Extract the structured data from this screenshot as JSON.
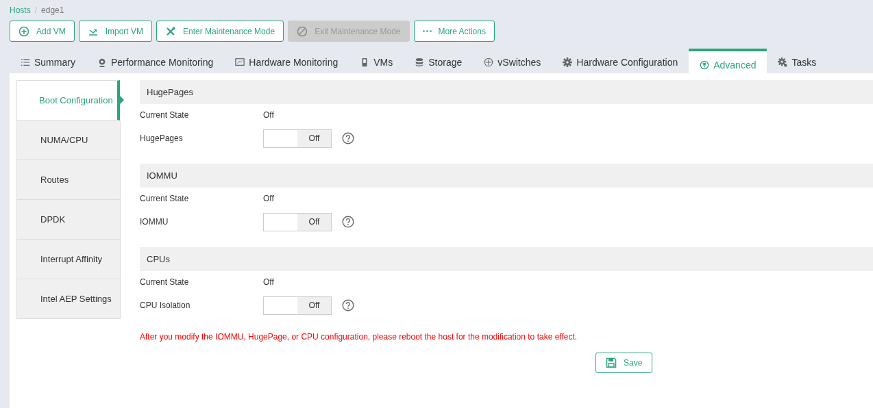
{
  "breadcrumb": {
    "items": [
      "Hosts",
      "edge1"
    ],
    "separator": "/"
  },
  "actions": [
    {
      "label": "Add VM",
      "disabled": false
    },
    {
      "label": "Import VM",
      "disabled": false
    },
    {
      "label": "Enter Maintenance Mode",
      "disabled": false
    },
    {
      "label": "Exit Maintenance Mode",
      "disabled": true
    },
    {
      "label": "More Actions",
      "disabled": false
    }
  ],
  "tabs": [
    {
      "label": "Summary",
      "selected": false
    },
    {
      "label": "Performance Monitoring",
      "selected": false
    },
    {
      "label": "Hardware Monitoring",
      "selected": false
    },
    {
      "label": "VMs",
      "selected": false
    },
    {
      "label": "Storage",
      "selected": false
    },
    {
      "label": "vSwitches",
      "selected": false
    },
    {
      "label": "Hardware Configuration",
      "selected": false
    },
    {
      "label": "Advanced",
      "selected": true
    },
    {
      "label": "Tasks",
      "selected": false
    }
  ],
  "sidebar": {
    "items": [
      {
        "label": "Boot Configuration",
        "selected": true
      },
      {
        "label": "NUMA/CPU",
        "selected": false
      },
      {
        "label": "Routes",
        "selected": false
      },
      {
        "label": "DPDK",
        "selected": false
      },
      {
        "label": "Interrupt Affinity",
        "selected": false
      },
      {
        "label": "Intel AEP Settings",
        "selected": false
      }
    ]
  },
  "sections": [
    {
      "title": "HugePages",
      "state_label": "Current State",
      "state_value": "Off",
      "switch_label": "HugePages",
      "switch": {
        "on": false,
        "text": "Off"
      }
    },
    {
      "title": "IOMMU",
      "state_label": "Current State",
      "state_value": "Off",
      "switch_label": "IOMMU",
      "switch": {
        "on": false,
        "text": "Off"
      }
    },
    {
      "title": "CPUs",
      "state_label": "Current State",
      "state_value": "Off",
      "switch_label": "CPU Isolation",
      "switch": {
        "on": false,
        "text": "Off"
      }
    }
  ],
  "notice": "After you modify the IOMMU, HugePage, or CPU configuration, please reboot the host for the modification to take effect.",
  "save_button": "Save"
}
